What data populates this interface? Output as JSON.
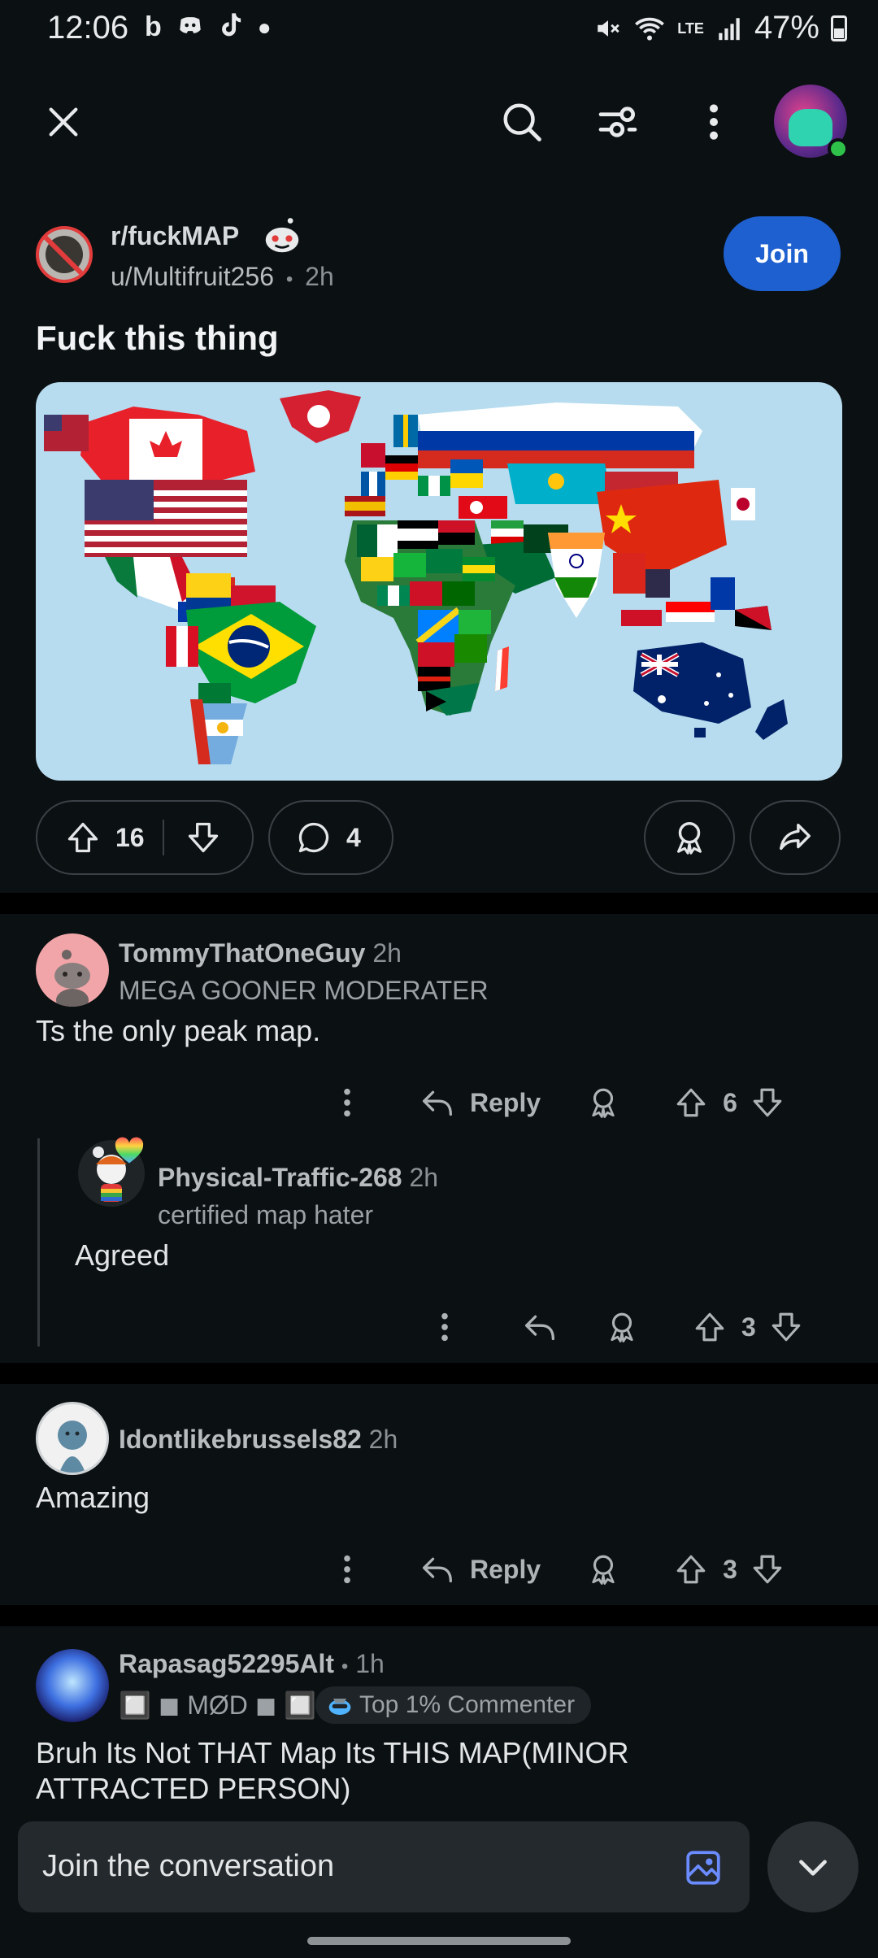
{
  "status_bar": {
    "time": "12:06",
    "battery": "47%",
    "network": "LTE"
  },
  "post": {
    "subreddit": "r/fuckMAP",
    "author": "u/Multifruit256",
    "age": "2h",
    "separator": "•",
    "title": "Fuck this thing",
    "join_label": "Join",
    "upvotes": "16",
    "comments": "4"
  },
  "comments": [
    {
      "user": "TommyThatOneGuy",
      "time": "2h",
      "flair": "MEGA GOONER MODERATER",
      "body": "Ts the only peak map.",
      "reply_label": "Reply",
      "score": "6"
    },
    {
      "user": "Physical-Traffic-268",
      "time": "2h",
      "flair": "certified map hater",
      "body": "Agreed",
      "score": "3"
    },
    {
      "user": "Idontlikebrussels82",
      "time": "2h",
      "body": "Amazing",
      "reply_label": "Reply",
      "score": "3"
    },
    {
      "user": "Rapasag52295Alt",
      "time": "1h",
      "separator": "•",
      "flair": "🔲 ◼ MØD ◼ 🔲",
      "badge": "Top 1% Commenter",
      "body": "Bruh Its Not THAT Map Its THIS MAP(MINOR ATTRACTED PERSON)"
    }
  ],
  "composer": {
    "placeholder": "Join the conversation"
  },
  "colors": {
    "background": "#0b1012",
    "join_button": "#1e60d0",
    "online": "#2ec24a",
    "map_ocean": "#b7dcef"
  },
  "icons": [
    "close-icon",
    "search-icon",
    "filter-icon",
    "more-vertical-icon",
    "upvote-icon",
    "downvote-icon",
    "comment-icon",
    "award-icon",
    "share-icon",
    "reply-icon",
    "image-icon",
    "chevron-down-icon"
  ]
}
